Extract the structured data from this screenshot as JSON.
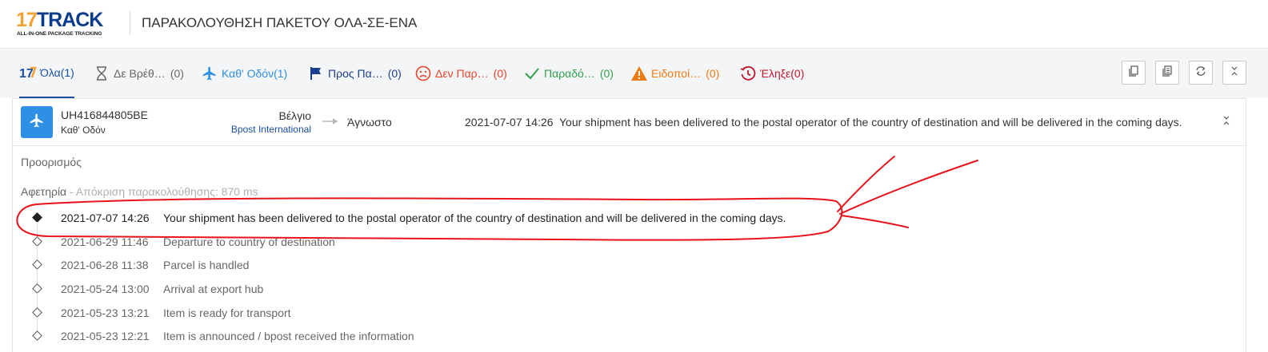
{
  "header": {
    "logo_num": "17",
    "logo_text": "TRACK",
    "logo_tagline": "ALL-IN-ONE PACKAGE TRACKING",
    "title": "ΠΑΡΑΚΟΛΟΥΘΗΣΗ ΠΑΚΕΤΟΥ ΟΛΑ-ΣΕ-ΕΝΑ"
  },
  "tabs": [
    {
      "icon": "17-logo-icon",
      "label": "Όλα(1)",
      "count": "",
      "color": "#1a4fa0",
      "active": true
    },
    {
      "icon": "hourglass-icon",
      "label": "Δε Βρέθ…",
      "count": "(0)",
      "color": "#666666",
      "active": false
    },
    {
      "icon": "plane-icon",
      "label": "Καθ' Οδόν(1)",
      "count": "",
      "color": "#2e8fe4",
      "active": false
    },
    {
      "icon": "flag-icon",
      "label": "Προς Πα…",
      "count": "(0)",
      "color": "#1a3f8f",
      "active": false
    },
    {
      "icon": "sad-face-icon",
      "label": "Δεν Παρ…",
      "count": "(0)",
      "color": "#e8452c",
      "active": false
    },
    {
      "icon": "check-icon",
      "label": "Παραδό…",
      "count": "(0)",
      "color": "#33a04c",
      "active": false
    },
    {
      "icon": "warning-icon",
      "label": "Ειδοποί…",
      "count": "(0)",
      "color": "#f07b12",
      "active": false
    },
    {
      "icon": "history-clock-icon",
      "label": "Έληξε(0)",
      "count": "",
      "color": "#c0162c",
      "active": false
    }
  ],
  "toolbar": [
    "copy-icon",
    "copy-all-icon",
    "refresh-icon",
    "collapse-all-icon"
  ],
  "shipment": {
    "tracking_number": "UH416844805BE",
    "status": "Καθ' Οδόν",
    "origin_country": "Βέλγιο",
    "carrier": "Bpost International",
    "destination_country": "Άγνωστο",
    "latest_time": "2021-07-07 14:26",
    "latest_event": "Your shipment has been delivered to the postal operator of the country of destination and will be delivered in the coming days."
  },
  "sections": {
    "destination_label": "Προορισμός",
    "origin_label": "Αφετηρία",
    "response_note": " - Απόκριση παρακολούθησης: 870 ms"
  },
  "events": [
    {
      "time": "2021-07-07 14:26",
      "description": "Your shipment has been delivered to the postal operator of the country of destination and will be delivered in the coming days."
    },
    {
      "time": "2021-06-29 11:46",
      "description": "Departure to country of destination"
    },
    {
      "time": "2021-06-28 11:38",
      "description": "Parcel is handled"
    },
    {
      "time": "2021-05-24 13:00",
      "description": "Arrival at export hub"
    },
    {
      "time": "2021-05-23 13:21",
      "description": "Item is ready for transport"
    },
    {
      "time": "2021-05-23 12:21",
      "description": "Item is announced / bpost received the information"
    }
  ],
  "colors": {
    "brand_blue": "#1a4fa0",
    "brand_orange": "#f2a230",
    "in_transit_blue": "#2e8fe4",
    "annotation_red": "#e8131b"
  }
}
